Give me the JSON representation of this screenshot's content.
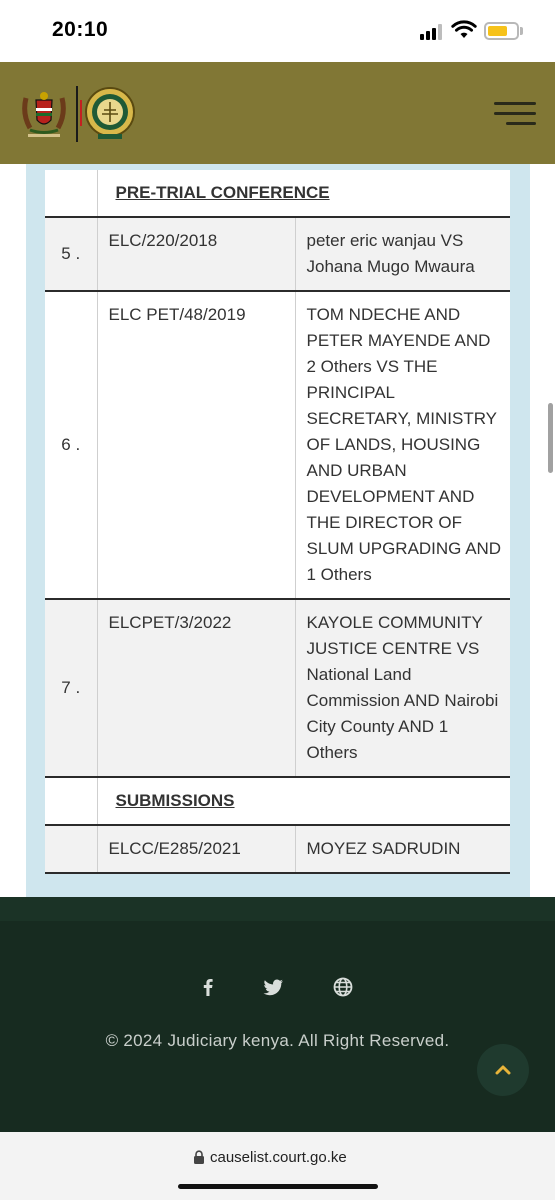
{
  "status_bar": {
    "time": "20:10"
  },
  "header": {
    "menu_label": "Menu"
  },
  "table": {
    "sections": [
      {
        "title": "PRE-TRIAL CONFERENCE",
        "rows": [
          {
            "no": "5 .",
            "case_no": "ELC/220/2018",
            "parties": "peter eric wanjau VS Johana Mugo Mwaura"
          },
          {
            "no": "6 .",
            "case_no": "ELC PET/48/2019",
            "parties": "TOM NDECHE AND PETER MAYENDE AND 2 Others VS THE PRINCIPAL SECRETARY, MINISTRY OF LANDS, HOUSING AND URBAN DEVELOPMENT AND THE DIRECTOR OF SLUM UPGRADING AND 1 Others"
          },
          {
            "no": "7 .",
            "case_no": "ELCPET/3/2022",
            "parties": "KAYOLE COMMUNITY JUSTICE CENTRE VS National Land Commission AND Nairobi City County AND 1 Others"
          }
        ]
      },
      {
        "title": "SUBMISSIONS",
        "rows": [
          {
            "no": "",
            "case_no": "ELCC/E285/2021",
            "parties": "MOYEZ SADRUDIN"
          }
        ]
      }
    ]
  },
  "footer": {
    "social_icons": [
      "facebook-icon",
      "twitter-icon",
      "globe-icon"
    ],
    "copyright": "© 2024 Judiciary kenya. All Right Reserved."
  },
  "browser": {
    "url": "causelist.court.go.ke"
  },
  "colors": {
    "header_bg": "#817735",
    "footer_bg": "#172b20",
    "table_frame": "#cfe6ee"
  }
}
